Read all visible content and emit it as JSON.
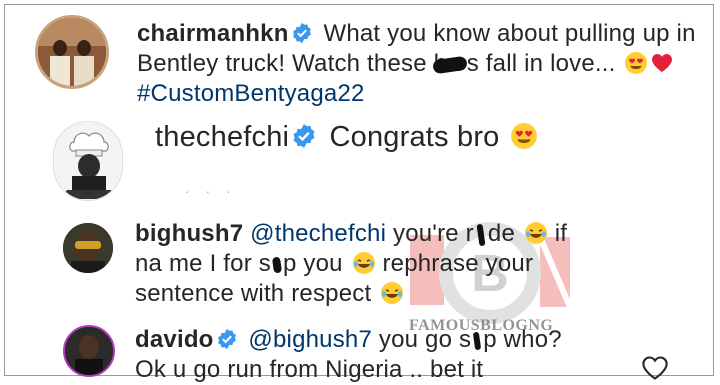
{
  "comments": [
    {
      "username": "chairmanhkn",
      "verified": true,
      "line1_text": "What you know about pulling up in",
      "line2_pre": "Bentley truck! Watch these ha",
      "line2_post": "s fall in love...",
      "hashtag": "#CustomBentyaga22"
    },
    {
      "username": "thechefchi",
      "verified": true,
      "text": "Congrats bro"
    },
    {
      "username": "bighush7",
      "mention": "@thechefchi",
      "line1_a": "you're r",
      "line1_b": "de",
      "line1_c": "if",
      "line2_a": "na me I for s",
      "line2_b": "p you",
      "line2_c": "rephrase your",
      "line3": "sentence with respect"
    },
    {
      "username": "davido",
      "verified": true,
      "mention": "@bighush7",
      "line1_a": "you go s",
      "line1_b": "p who?",
      "line2": "Ok u go run from Nigeria .. bet it"
    }
  ],
  "watermark": {
    "text": "FAMOUSBLOGNG"
  },
  "colors": {
    "verified_blue": "#3897f0",
    "link_blue": "#00376b",
    "watermark_red": "#e0322c"
  },
  "icons": {
    "verified": "verified-badge-icon",
    "like": "heart-icon",
    "emoji_heart_eyes": "heart-eyes-emoji",
    "emoji_laugh": "tears-of-joy-emoji",
    "emoji_red_heart": "red-heart-emoji"
  }
}
